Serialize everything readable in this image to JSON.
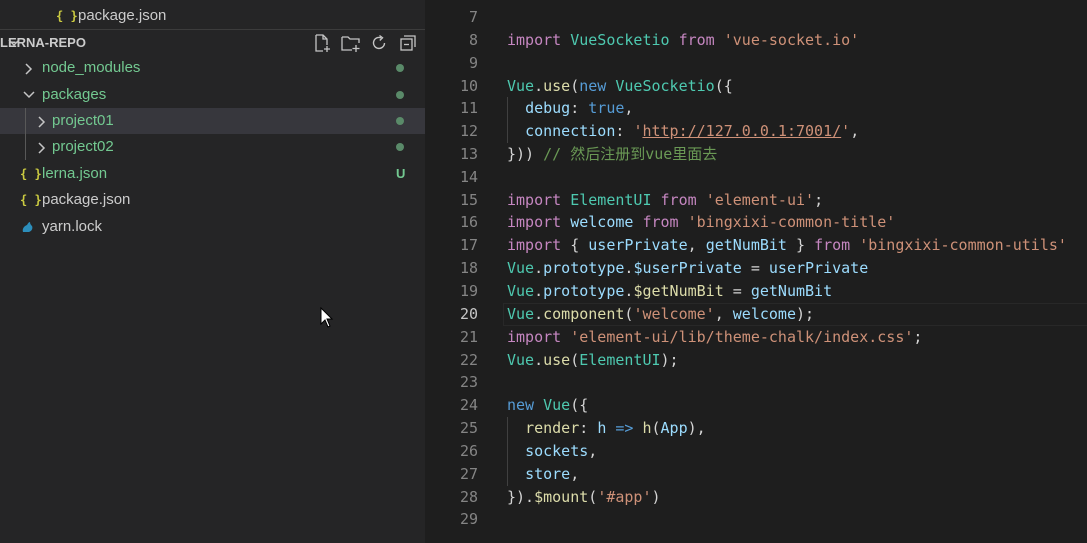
{
  "explorer": {
    "top_file": "package.json",
    "section_title": "LERNA-REPO",
    "header_icons": [
      "new-file-icon",
      "new-folder-icon",
      "refresh-icon",
      "collapse-all-icon"
    ],
    "tree": [
      {
        "label": "node_modules",
        "type": "folder",
        "status": "dot"
      },
      {
        "label": "packages",
        "type": "folder-open",
        "status": "dot"
      },
      {
        "label": "project01",
        "type": "folder",
        "status": "dot",
        "selected": true
      },
      {
        "label": "project02",
        "type": "folder",
        "status": "dot"
      },
      {
        "label": "lerna.json",
        "type": "json",
        "status": "U"
      },
      {
        "label": "package.json",
        "type": "json"
      },
      {
        "label": "yarn.lock",
        "type": "yarn"
      }
    ]
  },
  "editor": {
    "active_line": "20",
    "line_numbers": [
      "7",
      "8",
      "9",
      "10",
      "11",
      "12",
      "13",
      "14",
      "15",
      "16",
      "17",
      "18",
      "19",
      "20",
      "21",
      "22",
      "23",
      "24",
      "25",
      "26",
      "27",
      "28",
      "29"
    ],
    "tokens": {
      "l8": [
        "import",
        " VueSocketio ",
        "from",
        " ",
        "'vue-socket.io'"
      ],
      "l10": [
        "Vue",
        ".",
        "use",
        "(",
        "new",
        " ",
        "VueSocketio",
        "({"
      ],
      "l11": [
        "  ",
        "debug",
        ": ",
        "true",
        ","
      ],
      "l12": [
        "  ",
        "connection",
        ": ",
        "'",
        "http://127.0.0.1:7001/",
        "'",
        ","
      ],
      "l13": [
        "})) ",
        "// 然后注册到vue里面去"
      ],
      "l15": [
        "import",
        " ElementUI ",
        "from",
        " ",
        "'element-ui'",
        ";"
      ],
      "l16": [
        "import",
        " welcome ",
        "from",
        " ",
        "'bingxixi-common-title'"
      ],
      "l17": [
        "import",
        " { ",
        "userPrivate",
        ", ",
        "getNumBit",
        " } ",
        "from",
        " ",
        "'bingxixi-common-utils'"
      ],
      "l18": [
        "Vue",
        ".",
        "prototype",
        ".",
        "$userPrivate",
        " = ",
        "userPrivate"
      ],
      "l19": [
        "Vue",
        ".",
        "prototype",
        ".",
        "$getNumBit",
        " = ",
        "getNumBit"
      ],
      "l20": [
        "Vue",
        ".",
        "component",
        "(",
        "'welcome'",
        ", ",
        "welcome",
        ");"
      ],
      "l21": [
        "import",
        " ",
        "'element-ui/lib/theme-chalk/index.css'",
        ";"
      ],
      "l22": [
        "Vue",
        ".",
        "use",
        "(",
        "ElementUI",
        ");"
      ],
      "l24": [
        "new",
        " ",
        "Vue",
        "({"
      ],
      "l25": [
        "  ",
        "render",
        ": ",
        "h",
        " ",
        "=>",
        " ",
        "h",
        "(",
        "App",
        "),"
      ],
      "l26": [
        "  ",
        "sockets",
        ","
      ],
      "l27": [
        "  ",
        "store",
        ","
      ],
      "l28": [
        "}).",
        "$mount",
        "(",
        "'#app'",
        ")"
      ]
    }
  },
  "colors": {
    "sidebar_bg": "#252526",
    "editor_bg": "#1e1e1e",
    "selected_row": "#37373d",
    "git_green": "#73c991",
    "keyword_blue": "#569cd6",
    "control_purple": "#c586c0",
    "string_orange": "#ce9178",
    "variable_lightblue": "#9cdcfe",
    "function_yellow": "#dcdcaa",
    "comment_green": "#6a9955"
  }
}
